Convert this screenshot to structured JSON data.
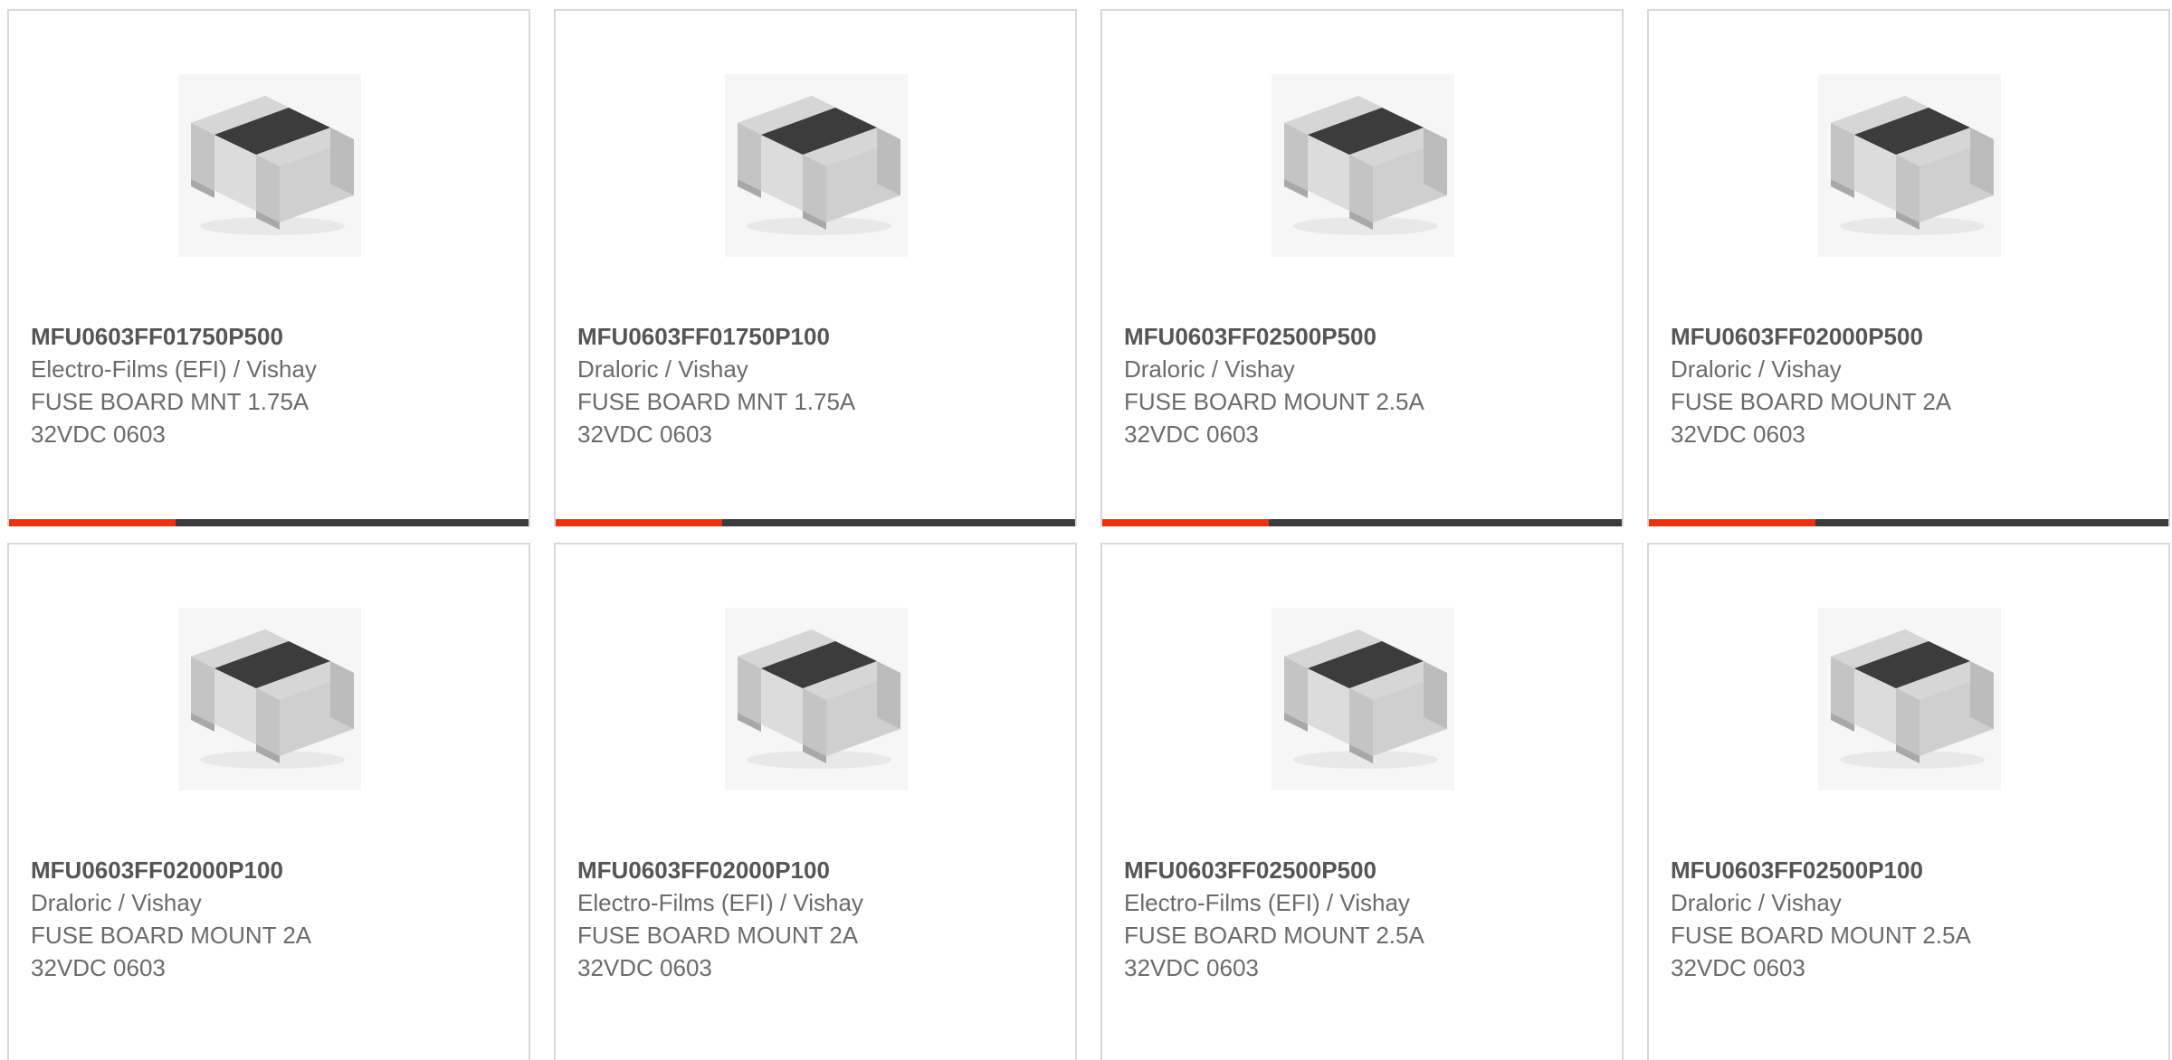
{
  "colors": {
    "accent": "#e63312",
    "track": "#3b3b3b",
    "border": "#d9d9d9",
    "title_text": "#555555",
    "body_text": "#6b6b6b"
  },
  "image_icon": "smd-chip-fuse-image",
  "products": [
    {
      "part_number": "MFU0603FF01750P500",
      "manufacturer": "Electro-Films (EFI) / Vishay",
      "description": "FUSE BOARD MNT 1.75A 32VDC 0603",
      "progress_fraction": 0.32
    },
    {
      "part_number": "MFU0603FF01750P100",
      "manufacturer": "Draloric / Vishay",
      "description": "FUSE BOARD MNT 1.75A 32VDC 0603",
      "progress_fraction": 0.32
    },
    {
      "part_number": "MFU0603FF02500P500",
      "manufacturer": "Draloric / Vishay",
      "description": "FUSE BOARD MOUNT 2.5A 32VDC 0603",
      "progress_fraction": 0.32
    },
    {
      "part_number": "MFU0603FF02000P500",
      "manufacturer": "Draloric / Vishay",
      "description": "FUSE BOARD MOUNT 2A 32VDC 0603",
      "progress_fraction": 0.32
    },
    {
      "part_number": "MFU0603FF02000P100",
      "manufacturer": "Draloric / Vishay",
      "description": "FUSE BOARD MOUNT 2A 32VDC 0603"
    },
    {
      "part_number": "MFU0603FF02000P100",
      "manufacturer": "Electro-Films (EFI) / Vishay",
      "description": "FUSE BOARD MOUNT 2A 32VDC 0603"
    },
    {
      "part_number": "MFU0603FF02500P500",
      "manufacturer": "Electro-Films (EFI) / Vishay",
      "description": "FUSE BOARD MOUNT 2.5A 32VDC 0603"
    },
    {
      "part_number": "MFU0603FF02500P100",
      "manufacturer": "Draloric / Vishay",
      "description": "FUSE BOARD MOUNT 2.5A 32VDC 0603"
    }
  ]
}
